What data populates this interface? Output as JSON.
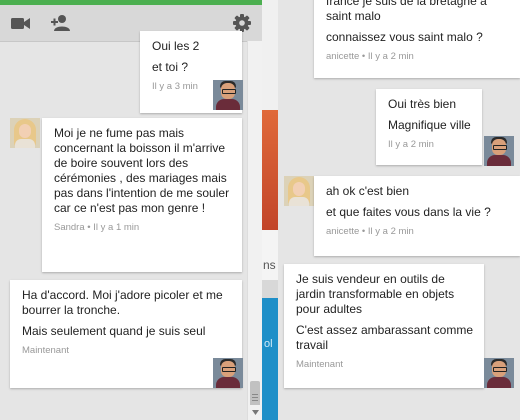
{
  "left_chat": {
    "toolbar": {
      "video_icon": "video-camera-icon",
      "add_person_icon": "add-person-icon",
      "settings_icon": "gear-icon"
    },
    "messages": [
      {
        "lines": [
          "Oui les 2",
          "et toi ?"
        ],
        "meta": "Il y a 3 min",
        "sender": "me"
      },
      {
        "lines": [
          "Moi je ne fume pas mais concernant la boisson il m'arrive de boire souvent lors des cérémonies , des mariages mais pas dans l'intention de me souler car ce n'est pas mon genre !"
        ],
        "meta": "Sandra • Il y a 1 min",
        "sender": "Sandra"
      },
      {
        "lines": [
          "Ha d'accord. Moi j'adore picoler et me bourrer la tronche.",
          "Mais seulement quand je suis seul"
        ],
        "meta": "Maintenant",
        "sender": "me"
      }
    ]
  },
  "background_fragments": {
    "text1": "ns",
    "text2": "ol"
  },
  "right_chat": {
    "messages": [
      {
        "lines": [
          "france je suis de la bretagne à saint malo",
          "connaissez vous saint malo ?"
        ],
        "meta": "anicette • Il y a 2 min",
        "sender": "anicette"
      },
      {
        "lines": [
          "Oui très bien",
          "Magnifique ville"
        ],
        "meta": "Il y a 2 min",
        "sender": "me"
      },
      {
        "lines": [
          "ah ok c'est bien",
          "et que faites vous dans la vie ?"
        ],
        "meta": "anicette • Il y a 2 min",
        "sender": "anicette"
      },
      {
        "lines": [
          "Je suis vendeur en outils de jardin transformable en objets pour adultes",
          "C'est assez ambarassant comme travail"
        ],
        "meta": "Maintenant",
        "sender": "me"
      }
    ]
  }
}
